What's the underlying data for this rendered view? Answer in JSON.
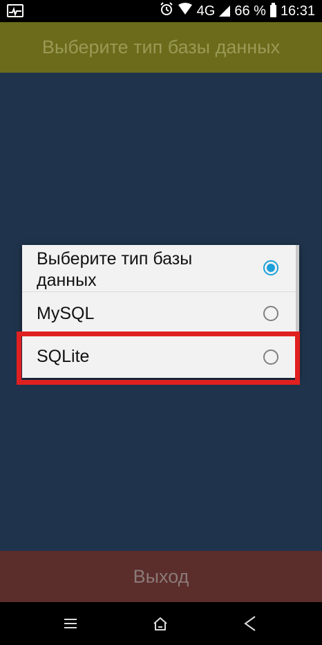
{
  "status": {
    "left_icon": "activity-pulse-icon",
    "alarm_icon": "alarm-clock-icon",
    "wifi_icon": "wifi-icon",
    "network": "4G",
    "signal_icon": "signal-icon",
    "battery_percent": "66 %",
    "battery_icon": "battery-icon",
    "time": "16:31"
  },
  "app": {
    "header_button": "Выберите тип базы данных",
    "exit_button": "Выход"
  },
  "dialog": {
    "options": [
      {
        "label": "Выберите тип базы данных",
        "selected": true
      },
      {
        "label": "MySQL",
        "selected": false
      },
      {
        "label": "SQLite",
        "selected": false
      }
    ]
  },
  "annotation": {
    "highlight_color": "#e02020",
    "highlighted_option": "SQLite"
  },
  "navbar": {
    "menu_icon": "menu-lines-icon",
    "home_icon": "home-icon",
    "back_icon": "back-chevron-icon"
  },
  "colors": {
    "app_background": "#1f344c",
    "header_button": "#6b6b1b",
    "exit_button": "#5b2d2b",
    "radio_selected": "#1ca0d9"
  }
}
